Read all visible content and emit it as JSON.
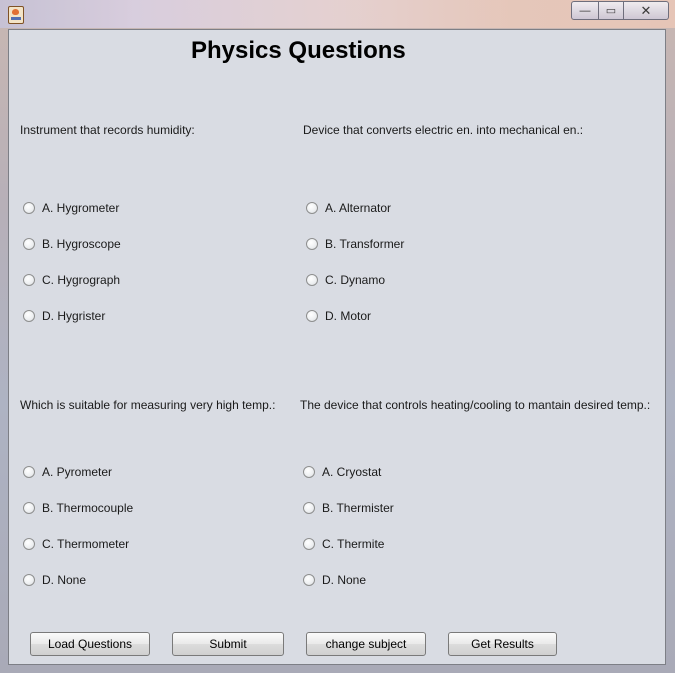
{
  "window": {
    "controls": {
      "minimize": "—",
      "maximize": "▭",
      "close": "✕"
    }
  },
  "header": {
    "title": "Physics Questions"
  },
  "questions": [
    {
      "text": "Instrument that records humidity:",
      "options": [
        "A. Hygrometer",
        "B. Hygroscope",
        "C. Hygrograph",
        "D. Hygrister"
      ]
    },
    {
      "text": "Device that converts electric en. into mechanical en.:",
      "options": [
        "A. Alternator",
        "B. Transformer",
        "C. Dynamo",
        "D. Motor"
      ]
    },
    {
      "text": "Which is suitable for measuring very high temp.:",
      "options": [
        "A. Pyrometer",
        "B. Thermocouple",
        "C. Thermometer",
        "D. None"
      ]
    },
    {
      "text": "The device that controls heating/cooling to mantain desired temp.:",
      "options": [
        "A. Cryostat",
        "B. Thermister",
        "C. Thermite",
        "D. None"
      ]
    }
  ],
  "buttons": {
    "load": "Load Questions",
    "submit": "Submit",
    "change": "change subject",
    "results": "Get Results"
  }
}
